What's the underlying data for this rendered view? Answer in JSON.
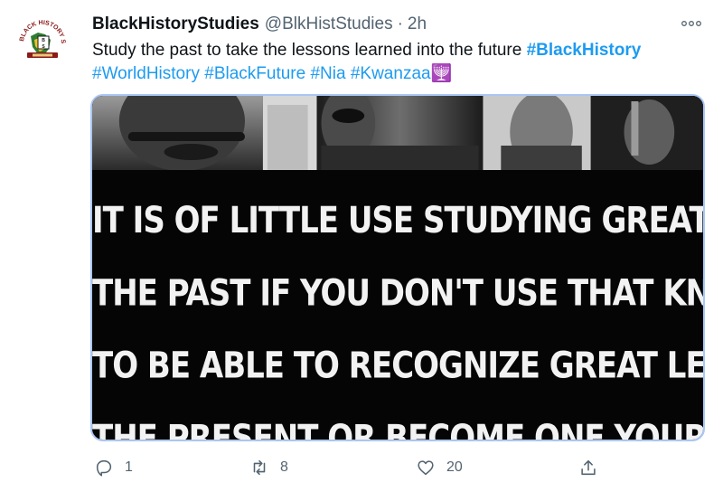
{
  "tweet": {
    "display_name": "BlackHistoryStudies",
    "handle": "@BlkHistStudies",
    "separator": "·",
    "time": "2h",
    "text": "Study the past to take the lessons learned into the future",
    "hashtags": [
      "#BlackHistory",
      "#WorldHistory",
      "#BlackFuture",
      "#Nia",
      "#Kwanzaa"
    ],
    "emoji": "🕎",
    "avatar_logo_text": "BLACK HISTORY STUDIES"
  },
  "media": {
    "quote_lines": [
      "IT IS OF LITTLE USE STUDYING GREAT LEADERS OF",
      "THE PAST IF YOU DON'T USE THAT KNOWLEDGE",
      "TO BE ABLE TO RECOGNIZE GREAT LEADERS IN",
      "THE PRESENT OR BECOME ONE YOURSELF."
    ]
  },
  "actions": {
    "reply_count": "1",
    "retweet_count": "8",
    "like_count": "20"
  },
  "colors": {
    "link": "#1d9bf0",
    "muted": "#536471",
    "media_border": "#a9c6f5"
  }
}
